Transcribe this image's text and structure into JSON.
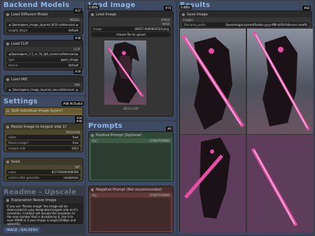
{
  "groups": {
    "backend": "Backend Models",
    "load_image": "Load Image",
    "results": "Results",
    "settings": "Settings",
    "prompts": "Prompts",
    "readme": "Readme - Upscale"
  },
  "diffusion": {
    "title": "Load Diffusion Model",
    "badge": "#37",
    "output": "MODEL",
    "unet_name": "Qwen/qwen_image_layered_bf16.safetensors",
    "weight_dtype_label": "weight_dtype",
    "weight_dtype": "default"
  },
  "clip": {
    "title": "Load CLIP",
    "badge": "#38",
    "output": "CLIP",
    "clip_name": "Qwen/qwen_2.5_vl_7b_fp8_scaled.safetensors",
    "type_label": "type",
    "type": "qwen_image",
    "device_label": "device",
    "device": "default"
  },
  "vae": {
    "title": "Load VAE",
    "badge": "#39",
    "output": "VAE",
    "vae_name": "Qwen/qwen_image_layered_vae.safetensors"
  },
  "load_image_node": {
    "title": "Load Image",
    "badge": "#74",
    "out_image": "IMAGE",
    "out_mask": "MASK",
    "image_label": "image",
    "image_name": "00057-0000816524.png",
    "upload_label": "choose file to upload",
    "size_label": "883×1328",
    "corner_badge": "0.00%"
  },
  "save_image": {
    "title": "Save Image",
    "badge": "#83",
    "images_label": "images",
    "prefix_label": "filename_prefix",
    "prefix": "QwenImageLayered/%date:yyyy-MM-dd%/%Kersen:seed%",
    "corner_badge": "3.485s"
  },
  "settings_nodes": {
    "mood_title": "Split individual image layers?",
    "mood_badge": "#88",
    "resize_title": "Resize Image to longest side 1?",
    "resize_badge": "#46",
    "boolean_label": "BOOLEAN",
    "value_label": "value",
    "value": "true",
    "resize_q_label": "Resize image?",
    "resize_q_value": "true",
    "longest_label": "longest side",
    "longest_value": "1024",
    "seed_title": "Seed",
    "seed_out": "INT",
    "seed_label": "value",
    "seed_value": "827700494096098",
    "control_label": "control after generate",
    "control_value": "randomize",
    "mctoolkit_badge": "#88 McToolkit"
  },
  "positive": {
    "title": "Positive Prompt (Optional)",
    "badge": "#6",
    "clip_in": "clip",
    "out": "CONDITIONING"
  },
  "negative": {
    "title": "Negative Prompt (Not recommended)",
    "badge": "#7",
    "clip_in": "clip",
    "out": "CONDITIONING"
  },
  "readme": {
    "title": "Explanation Resize Image",
    "text": "If you use \"Resize image\" the image will be downscaled to your designated longest side as it's resolution. ComfyUI will rescale the resolution to the next number that is divisible by 8. Use it to save VRAM or if your image is larger(2048px and upwards).",
    "image_chip": "IMAGE / BACKEND"
  },
  "colors": {
    "background": "#3a3f4d",
    "group_blue": "#3e4a61",
    "group_green": "#3d5a46",
    "group_red": "#5e3a3a",
    "accent_pink": "#e64fa3"
  }
}
